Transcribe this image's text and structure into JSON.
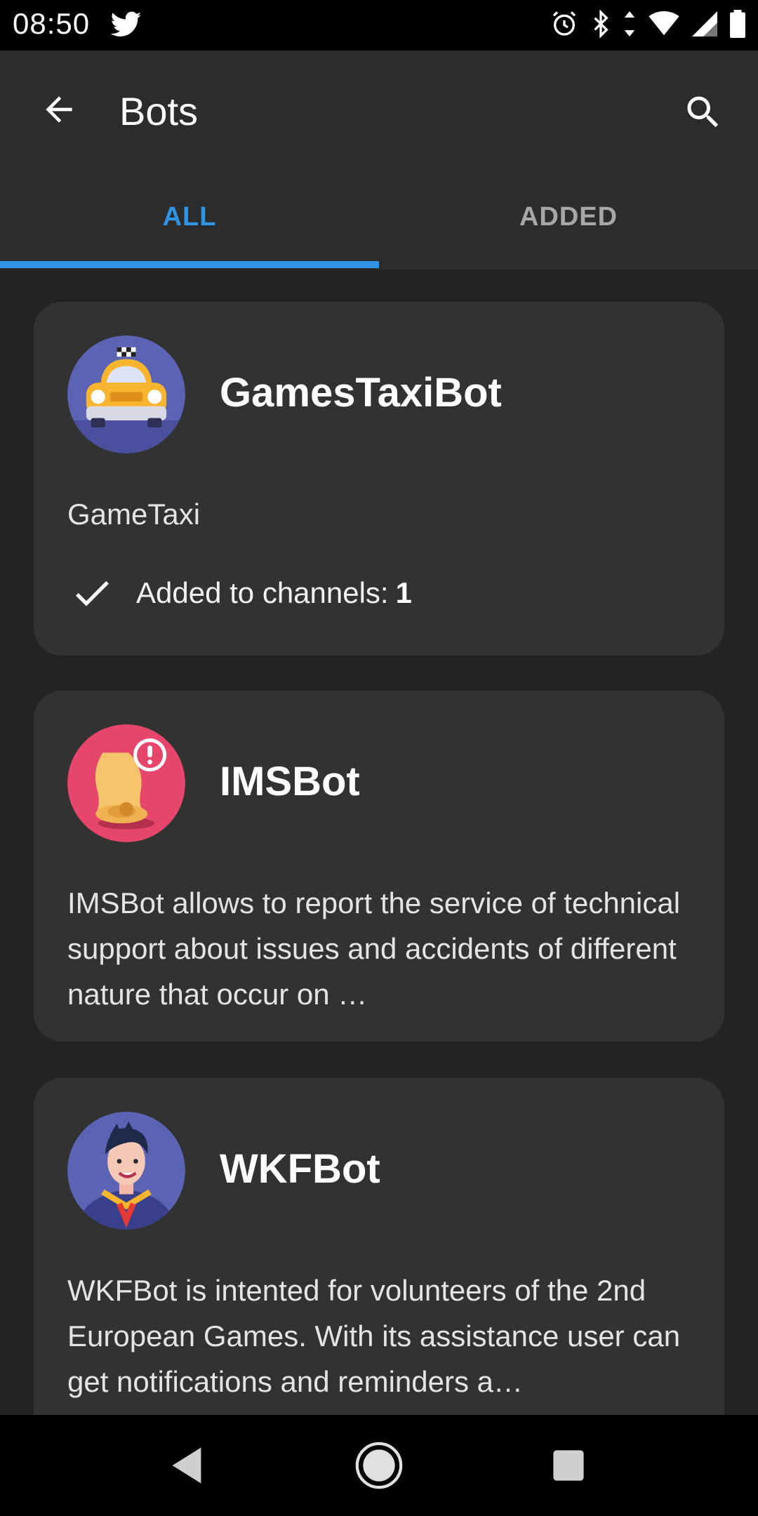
{
  "status_bar": {
    "time": "08:50",
    "icons": [
      "twitter-icon",
      "alarm-icon",
      "bluetooth-icon",
      "data-arrows-icon",
      "wifi-icon",
      "signal-icon",
      "battery-icon"
    ]
  },
  "app_bar": {
    "title": "Bots",
    "back_icon": "arrow-left-icon",
    "search_icon": "search-icon"
  },
  "tabs": [
    {
      "label": "ALL",
      "selected": true
    },
    {
      "label": "ADDED",
      "selected": false
    }
  ],
  "colors": {
    "accent": "#2f93e6",
    "background": "#232323",
    "card": "#323232",
    "app_bar": "#2c2c2c"
  },
  "bots": [
    {
      "name": "GamesTaxiBot",
      "description": "GameTaxi",
      "avatar": "taxi-avatar",
      "added_label": "Added to channels:",
      "added_count": "1"
    },
    {
      "name": "IMSBot",
      "description": "IMSBot allows to report the service of technical support about issues and accidents of different nature that occur on …",
      "avatar": "bell-alert-avatar"
    },
    {
      "name": "WKFBot",
      "description": "WKFBot is intented for volunteers of the 2nd European Games. With its assistance user can get notifications and reminders a…",
      "avatar": "volunteer-avatar"
    }
  ],
  "nav_bar": {
    "icons": [
      "nav-back-icon",
      "nav-home-icon",
      "nav-recents-icon"
    ]
  }
}
